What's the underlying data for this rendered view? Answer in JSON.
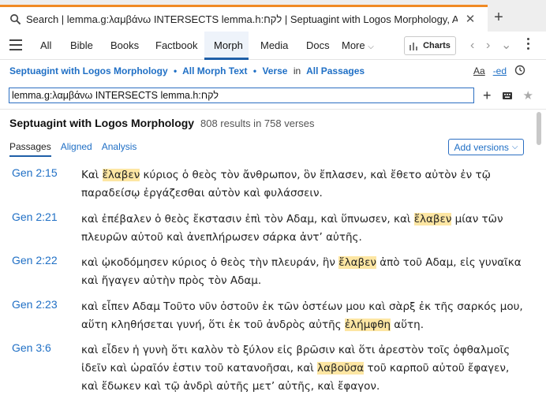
{
  "tab": {
    "title": "Search | lemma.g:λαμβάνω INTERSECTS lemma.h:לקח | Septuagint with Logos Morphology, All Passages",
    "close": "✕",
    "new_tab": "+"
  },
  "toolbar": {
    "items": [
      "All",
      "Bible",
      "Books",
      "Factbook",
      "Morph",
      "Media",
      "Docs",
      "More"
    ],
    "active": "Morph",
    "charts_label": "Charts",
    "back": "‹",
    "forward": "›",
    "history": "⌄"
  },
  "crumbs": {
    "resource": "Septuagint with Logos Morphology",
    "sep1": "•",
    "scope": "All Morph Text",
    "sep2": "•",
    "unit": "Verse",
    "in": "in",
    "range": "All Passages",
    "tool_aa": "Aa",
    "tool_ed": "-ed"
  },
  "query": {
    "value": "lemma.g:λαμβάνω INTERSECTS lemma.h:לקח"
  },
  "results": {
    "resource": "Septuagint with Logos Morphology",
    "count": "808 results in 758 verses"
  },
  "subtabs": [
    "Passages",
    "Aligned",
    "Analysis"
  ],
  "add_versions": "Add versions",
  "verses": [
    {
      "ref": "Gen 2:15",
      "before": "Καὶ ",
      "hit": "ἔλαβεν",
      "after": " κύριος ὁ θεὸς τὸν ἄνθρωπον, ὃν ἔπλασεν, καὶ ἔθετο αὐτὸν ἐν τῷ παραδείσῳ ἐργάζεσθαι αὐτὸν καὶ φυλάσσειν."
    },
    {
      "ref": "Gen 2:21",
      "before": "καὶ ἐπέβαλεν ὁ θεὸς ἔκστασιν ἐπὶ τὸν Αδαμ, καὶ ὕπνωσεν, καὶ ",
      "hit": "ἔλαβεν",
      "after": " μίαν τῶν πλευρῶν αὐτοῦ καὶ ἀνεπλήρωσεν σάρκα ἀντ’ αὐτῆς."
    },
    {
      "ref": "Gen 2:22",
      "before": "καὶ ᾠκοδόμησεν κύριος ὁ θεὸς τὴν πλευράν, ἣν ",
      "hit": "ἔλαβεν",
      "after": " ἀπὸ τοῦ Αδαμ, εἰς γυναῖκα καὶ ἤγαγεν αὐτὴν πρὸς τὸν Αδαμ."
    },
    {
      "ref": "Gen 2:23",
      "before": "καὶ εἶπεν Αδαμ Τοῦτο νῦν ὀστοῦν ἐκ τῶν ὀστέων μου καὶ σὰρξ ἐκ τῆς σαρκός μου, αὕτη κληθήσεται γυνή, ὅτι ἐκ τοῦ ἀνδρὸς αὐτῆς ",
      "hit": "ἐλήμφθη",
      "after": " αὕτη."
    },
    {
      "ref": "Gen 3:6",
      "before": "καὶ εἶδεν ἡ γυνὴ ὅτι καλὸν τὸ ξύλον εἰς βρῶσιν καὶ ὅτι ἀρεστὸν τοῖς ὀφθαλμοῖς ἰδεῖν καὶ ὡραῖόν ἐστιν τοῦ κατανοῆσαι, καὶ ",
      "hit": "λαβοῦσα",
      "after": " τοῦ καρποῦ αὐτοῦ ἔφαγεν, καὶ ἔδωκεν καὶ τῷ ἀνδρὶ αὐτῆς μετ’ αὐτῆς, καὶ ἔφαγον."
    }
  ]
}
